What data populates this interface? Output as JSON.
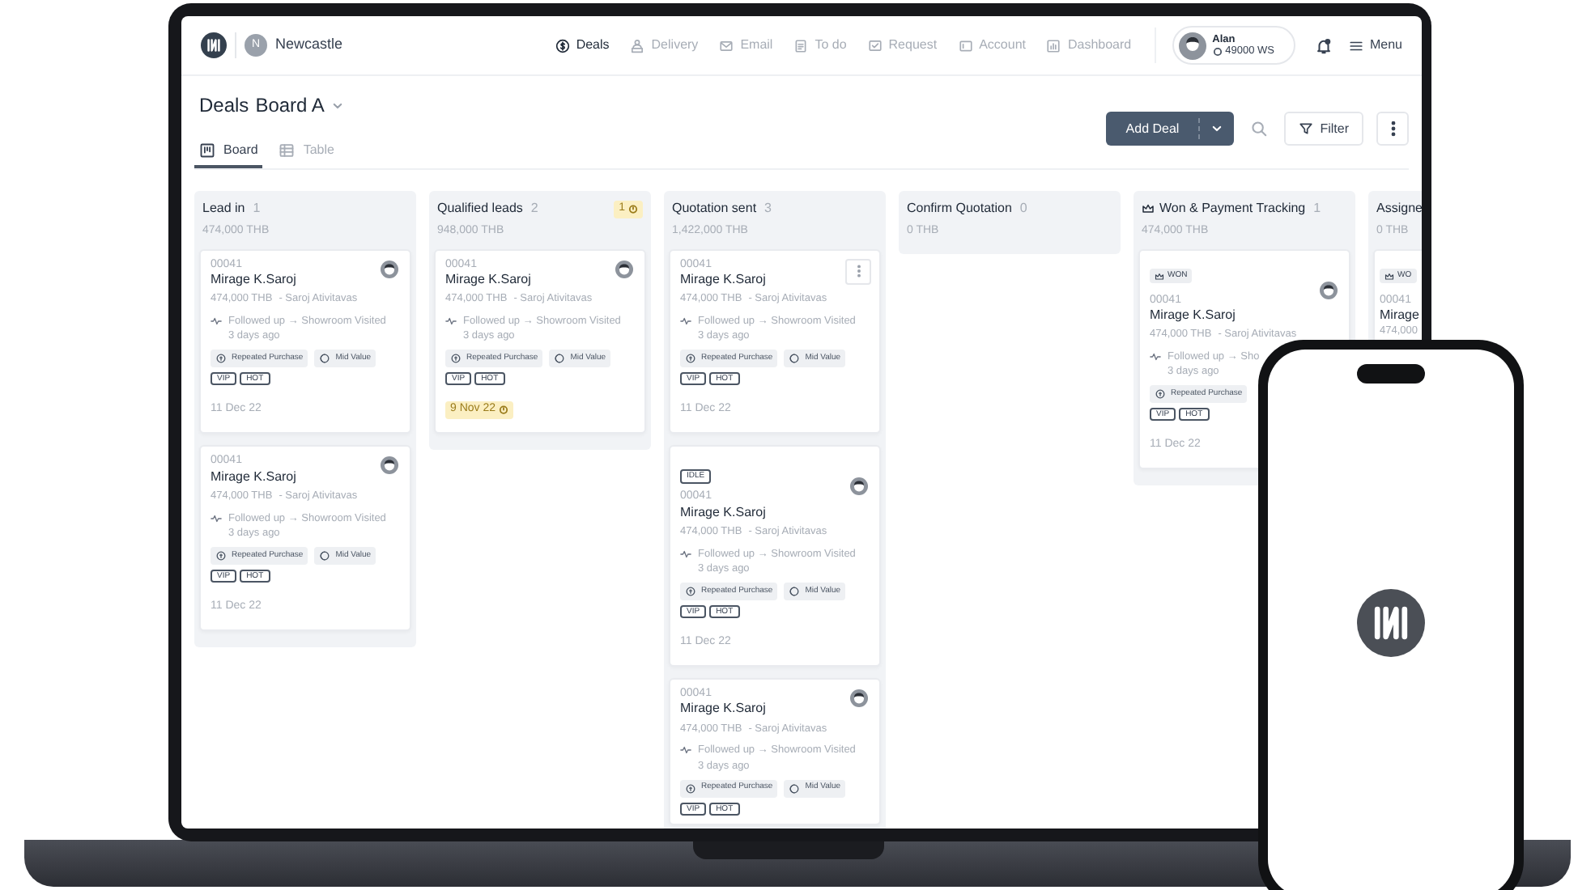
{
  "brand": {
    "workspace_initial": "N",
    "workspace": "Newcastle"
  },
  "nav": [
    {
      "label": "Deals",
      "selected": true
    },
    {
      "label": "Delivery",
      "selected": false
    },
    {
      "label": "Email",
      "selected": false
    },
    {
      "label": "To do",
      "selected": false
    },
    {
      "label": "Request",
      "selected": false
    },
    {
      "label": "Account",
      "selected": false
    },
    {
      "label": "Dashboard",
      "selected": false
    }
  ],
  "user": {
    "name": "Alan",
    "balance": "49000 WS"
  },
  "menu": "Menu",
  "page": {
    "title": "Deals",
    "board": "Board A"
  },
  "views": [
    {
      "label": "Board",
      "selected": true
    },
    {
      "label": "Table",
      "selected": false
    }
  ],
  "actions": {
    "add": "Add Deal",
    "filter": "Filter"
  },
  "columns": [
    {
      "kind": "normal",
      "title": "Lead in",
      "count": "1",
      "total": "474,000 THB",
      "cards": [
        {
          "avatar": true,
          "id": "00041",
          "name": "Mirage K.Saroj",
          "amount": "474,000 THB",
          "owner": "- Saroj Ativitavas",
          "activity": "Followed up → Showroom Visited",
          "ago": "3 days ago",
          "tags": [
            {
              "kind": "repeat",
              "label": "Repeated Purchase"
            },
            {
              "kind": "value",
              "label": "Mid Value"
            }
          ],
          "labels": [
            "VIP",
            "HOT"
          ],
          "date": "11 Dec 22",
          "overdue": false
        },
        {
          "avatar": true,
          "id": "00041",
          "name": "Mirage K.Saroj",
          "amount": "474,000 THB",
          "owner": "- Saroj Ativitavas",
          "activity": "Followed up → Showroom Visited",
          "ago": "3 days ago",
          "tags": [
            {
              "kind": "repeat",
              "label": "Repeated Purchase"
            },
            {
              "kind": "value",
              "label": "Mid Value"
            }
          ],
          "labels": [
            "VIP",
            "HOT"
          ],
          "date": "11 Dec 22",
          "overdue": false
        }
      ]
    },
    {
      "kind": "normal",
      "title": "Qualified leads",
      "count": "2",
      "total": "948,000 THB",
      "alert": "1",
      "cards": [
        {
          "avatar": true,
          "id": "00041",
          "name": "Mirage K.Saroj",
          "amount": "474,000 THB",
          "owner": "- Saroj Ativitavas",
          "activity": "Followed up → Showroom Visited",
          "ago": "3 days ago",
          "tags": [
            {
              "kind": "repeat",
              "label": "Repeated Purchase"
            },
            {
              "kind": "value",
              "label": "Mid Value"
            }
          ],
          "labels": [
            "VIP",
            "HOT"
          ],
          "date": "9 Nov 22",
          "overdue": true
        }
      ]
    },
    {
      "kind": "normal",
      "title": "Quotation sent",
      "count": "3",
      "total": "1,422,000 THB",
      "cards": [
        {
          "menu": true,
          "id": "00041",
          "name": "Mirage K.Saroj",
          "amount": "474,000 THB",
          "owner": "- Saroj Ativitavas",
          "activity": "Followed up → Showroom Visited",
          "ago": "3 days ago",
          "tags": [
            {
              "kind": "repeat",
              "label": "Repeated Purchase"
            },
            {
              "kind": "value",
              "label": "Mid Value"
            }
          ],
          "labels": [
            "VIP",
            "HOT"
          ],
          "date": "11 Dec 22",
          "overdue": false
        },
        {
          "status": {
            "kind": "idle",
            "label": "IDLE"
          },
          "avatar": true,
          "id": "00041",
          "name": "Mirage K.Saroj",
          "amount": "474,000 THB",
          "owner": "- Saroj Ativitavas",
          "activity": "Followed up → Showroom Visited",
          "ago": "3 days ago",
          "tags": [
            {
              "kind": "repeat",
              "label": "Repeated Purchase"
            },
            {
              "kind": "value",
              "label": "Mid Value"
            }
          ],
          "labels": [
            "VIP",
            "HOT"
          ],
          "date": "11 Dec 22",
          "overdue": false
        },
        {
          "avatar": true,
          "id": "00041",
          "name": "Mirage K.Saroj",
          "amount": "474,000 THB",
          "owner": "- Saroj Ativitavas",
          "activity": "Followed up → Showroom Visited",
          "ago": "3 days ago",
          "tags": [
            {
              "kind": "repeat",
              "label": "Repeated Purchase"
            },
            {
              "kind": "value",
              "label": "Mid Value"
            }
          ],
          "labels": [
            "VIP",
            "HOT"
          ]
        }
      ]
    },
    {
      "kind": "normal",
      "title": "Confirm Quotation",
      "count": "0",
      "total": "0 THB"
    },
    {
      "kind": "won",
      "title": "Won & Payment Tracking",
      "count": "1",
      "total": "474,000 THB",
      "cards": [
        {
          "status": {
            "kind": "won",
            "label": "WON"
          },
          "avatar": true,
          "id": "00041",
          "name": "Mirage K.Saroj",
          "amount": "474,000 THB",
          "owner": "- Saroj Ativitavas",
          "activity": "Followed up → Sho",
          "ago": "3 days ago",
          "tags": [
            {
              "kind": "repeat",
              "label": "Repeated Purchase"
            }
          ],
          "labels": [
            "VIP",
            "HOT"
          ],
          "date": "11 Dec 22",
          "overdue": false
        }
      ]
    },
    {
      "kind": "partial",
      "title": "Assigne",
      "total": "0 THB",
      "cards": [
        {
          "status": {
            "kind": "won",
            "label": "WO"
          },
          "id": "00041",
          "name": "Mirage",
          "amount": "474,000"
        }
      ]
    }
  ]
}
